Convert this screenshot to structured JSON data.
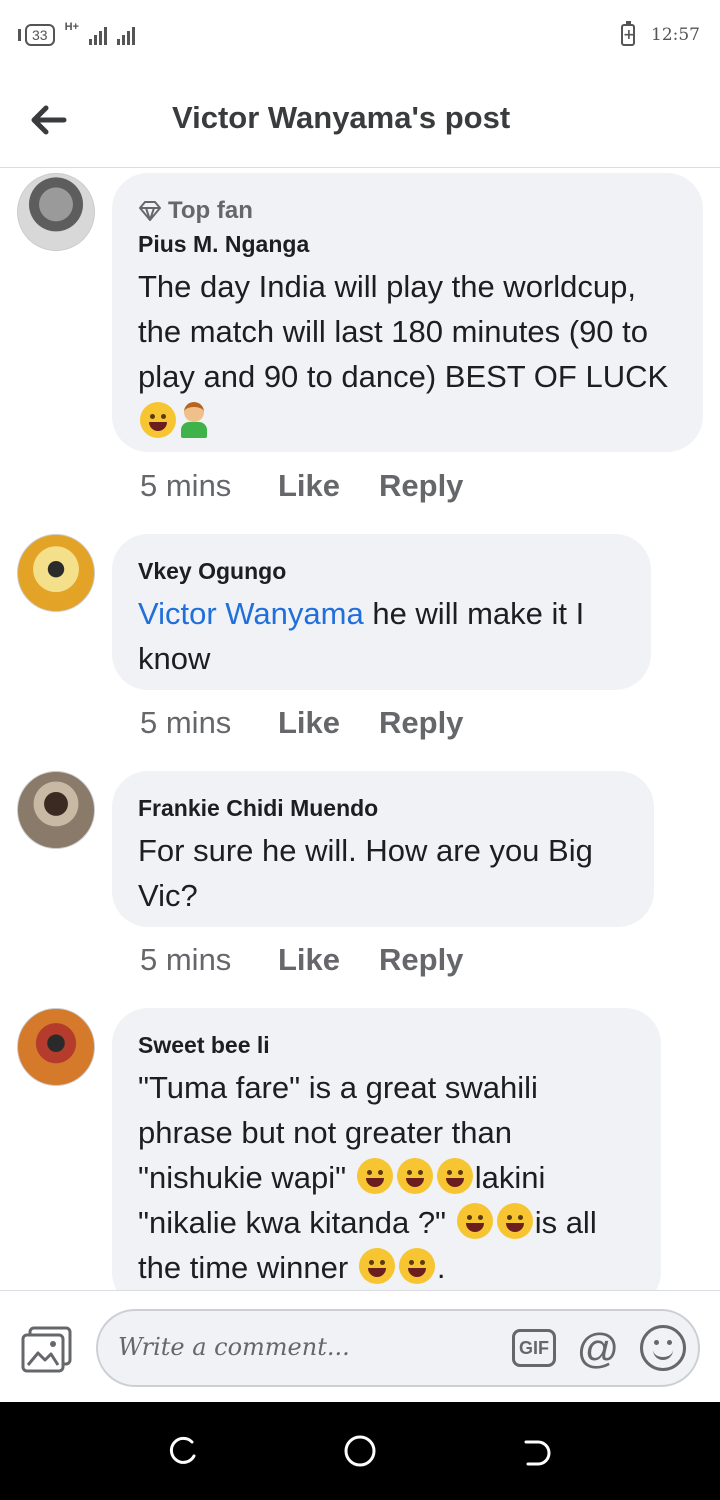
{
  "status_bar": {
    "badge": "33",
    "network": "H+",
    "battery_glyph": "+",
    "time": "12:57"
  },
  "header": {
    "title": "Victor Wanyama's post"
  },
  "comments": [
    {
      "badge": "Top fan",
      "author": "Pius M. Nganga",
      "text": "The day India will play the worldcup, the match will last 180 minutes (90 to play and 90 to dance) BEST OF LUCK",
      "time": "5 mins",
      "like": "Like",
      "reply": "Reply"
    },
    {
      "author": "Vkey Ogungo",
      "mention": "Victor Wanyama",
      "text": "he will make it I know",
      "time": "5 mins",
      "like": "Like",
      "reply": "Reply"
    },
    {
      "author": "Frankie Chidi Muendo",
      "text": "For sure he will. How are you Big Vic?",
      "time": "5 mins",
      "like": "Like",
      "reply": "Reply"
    },
    {
      "author": "Sweet bee li",
      "text_1": "\"Tuma fare\" is a great swahili phrase but not greater than \"nishukie wapi\"",
      "text_2": "lakini \"nikalie kwa kitanda ?\"",
      "text_3": "is all the time winner",
      "text_4": "."
    }
  ],
  "composer": {
    "placeholder": "Write a comment...",
    "gif_label": "GIF",
    "at_label": "@"
  },
  "colors": {
    "bubble": "#f0f2f5",
    "mention": "#216fdb",
    "muted": "#65676b"
  }
}
